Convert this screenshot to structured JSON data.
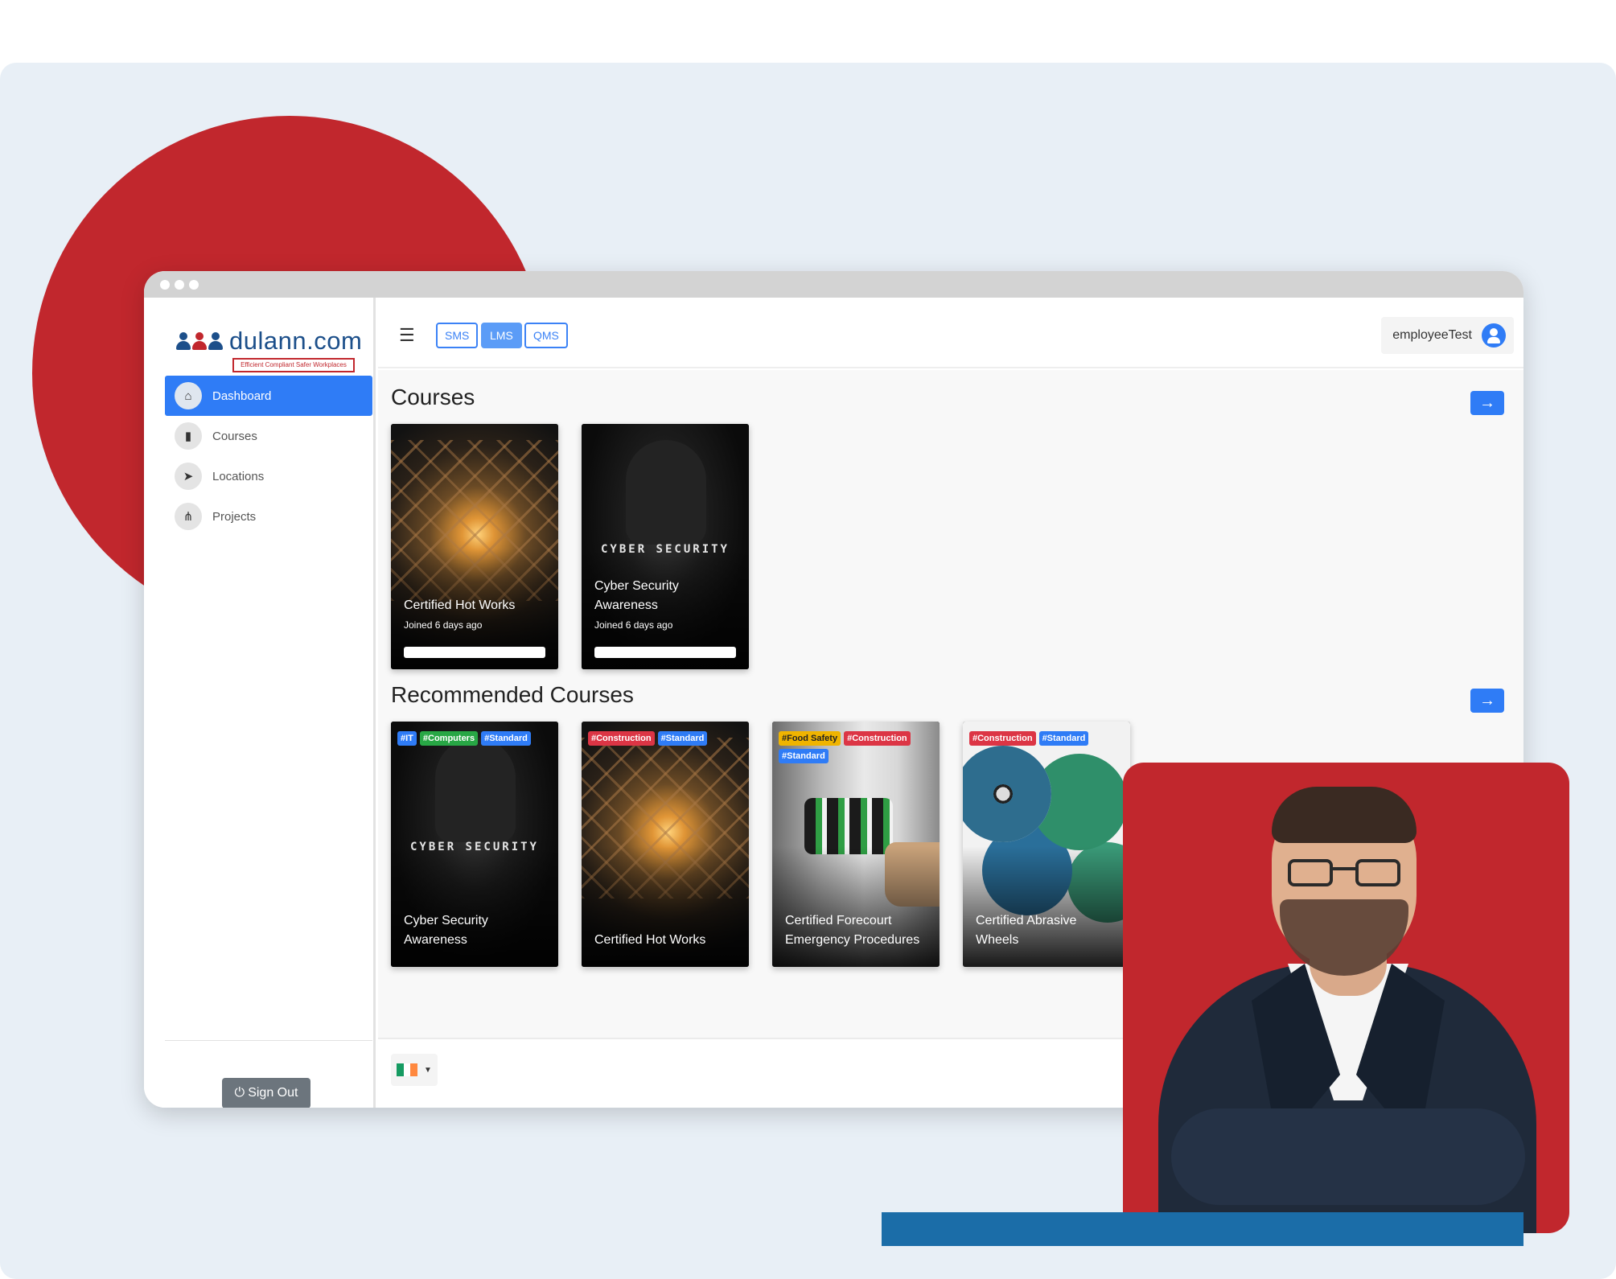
{
  "brand": {
    "name": "dulann.com",
    "tagline": "Efficient Compliant Safer Workplaces",
    "colors": {
      "primary_blue": "#2f7cf6",
      "brand_red": "#c1272d",
      "brand_navy": "#1c4f8a",
      "accent_bar": "#1b6da8"
    }
  },
  "sidebar": {
    "items": [
      {
        "label": "Dashboard",
        "icon": "home-icon",
        "active": true
      },
      {
        "label": "Courses",
        "icon": "book-icon",
        "active": false
      },
      {
        "label": "Locations",
        "icon": "location-arrow-icon",
        "active": false
      },
      {
        "label": "Projects",
        "icon": "project-diagram-icon",
        "active": false
      }
    ],
    "sign_out_label": "Sign Out"
  },
  "topbar": {
    "modules": [
      {
        "label": "SMS",
        "active": false
      },
      {
        "label": "LMS",
        "active": true
      },
      {
        "label": "QMS",
        "active": false
      }
    ],
    "username": "employeeTest"
  },
  "courses": {
    "title": "Courses",
    "items": [
      {
        "title": "Certified Hot Works",
        "subtitle": "Joined 6 days ago",
        "image": "hot-works"
      },
      {
        "title": "Cyber Security Awareness",
        "subtitle": "Joined 6 days ago",
        "image": "cyber-security",
        "image_text": "CYBER SECURITY"
      }
    ]
  },
  "recommended": {
    "title": "Recommended Courses",
    "items": [
      {
        "title": "Cyber Security Awareness",
        "image_text": "CYBER SECURITY",
        "tags": [
          {
            "label": "#IT",
            "color": "#2f7cf6"
          },
          {
            "label": "#Computers",
            "color": "#28a745"
          },
          {
            "label": "#Standard",
            "color": "#2f7cf6"
          }
        ]
      },
      {
        "title": "Certified Hot Works",
        "tags": [
          {
            "label": "#Construction",
            "color": "#dc3545"
          },
          {
            "label": "#Standard",
            "color": "#2f7cf6"
          }
        ]
      },
      {
        "title": "Certified Forecourt Emergency Procedures",
        "tags": [
          {
            "label": "#Food Safety",
            "color": "#f0b400"
          },
          {
            "label": "#Construction",
            "color": "#dc3545"
          },
          {
            "label": "#Standard",
            "color": "#2f7cf6"
          }
        ]
      },
      {
        "title": "Certified Abrasive Wheels",
        "tags": [
          {
            "label": "#Construction",
            "color": "#dc3545"
          },
          {
            "label": "#Standard",
            "color": "#2f7cf6"
          }
        ]
      }
    ]
  },
  "footer": {
    "language": "Irish flag",
    "flag_colors": [
      "#169b62",
      "#ffffff",
      "#ff883e"
    ]
  }
}
